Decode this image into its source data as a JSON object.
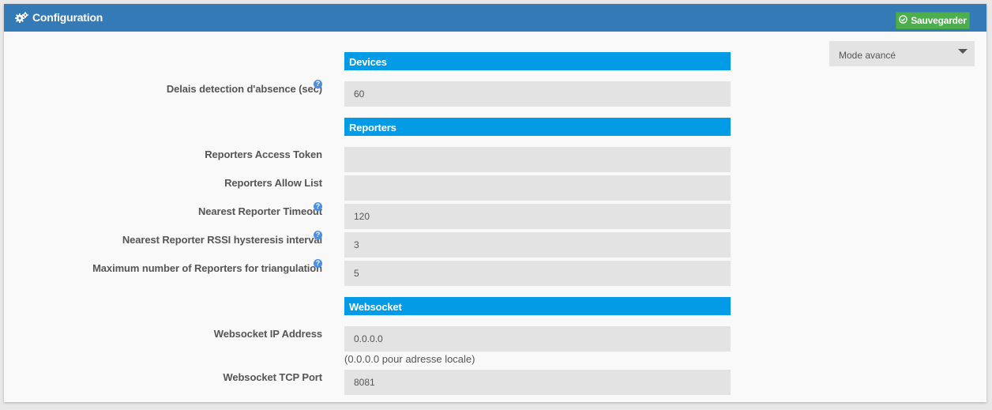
{
  "header": {
    "title": "Configuration",
    "title_icon": "cogs-icon",
    "save_label": "Sauvegarder",
    "save_icon": "check-circle-icon",
    "header_color": "#337ab7",
    "save_color": "#4cae4c"
  },
  "mode_select": {
    "selected": "Mode avancé"
  },
  "sections": {
    "devices": {
      "title": "Devices"
    },
    "reporters": {
      "title": "Reporters"
    },
    "websocket": {
      "title": "Websocket"
    }
  },
  "section_color": "#039be5",
  "fields": {
    "absence_delay": {
      "label": "Delais detection d'absence (sec)",
      "value": "60",
      "has_help": true
    },
    "access_token": {
      "label": "Reporters Access Token",
      "value": "",
      "has_help": false
    },
    "allow_list": {
      "label": "Reporters Allow List",
      "value": "",
      "has_help": false
    },
    "nearest_timeout": {
      "label": "Nearest Reporter Timeout",
      "value": "120",
      "has_help": true
    },
    "rssi_hysteresis": {
      "label": "Nearest Reporter RSSI hysteresis interval",
      "value": "3",
      "has_help": true
    },
    "max_reporters": {
      "label": "Maximum number of Reporters for triangulation",
      "value": "5",
      "has_help": true
    },
    "ws_ip": {
      "label": "Websocket IP Address",
      "value": "0.0.0.0",
      "hint": "(0.0.0.0 pour adresse locale)",
      "has_help": false
    },
    "ws_port": {
      "label": "Websocket TCP Port",
      "value": "8081",
      "has_help": false
    }
  },
  "help_glyph": "?"
}
